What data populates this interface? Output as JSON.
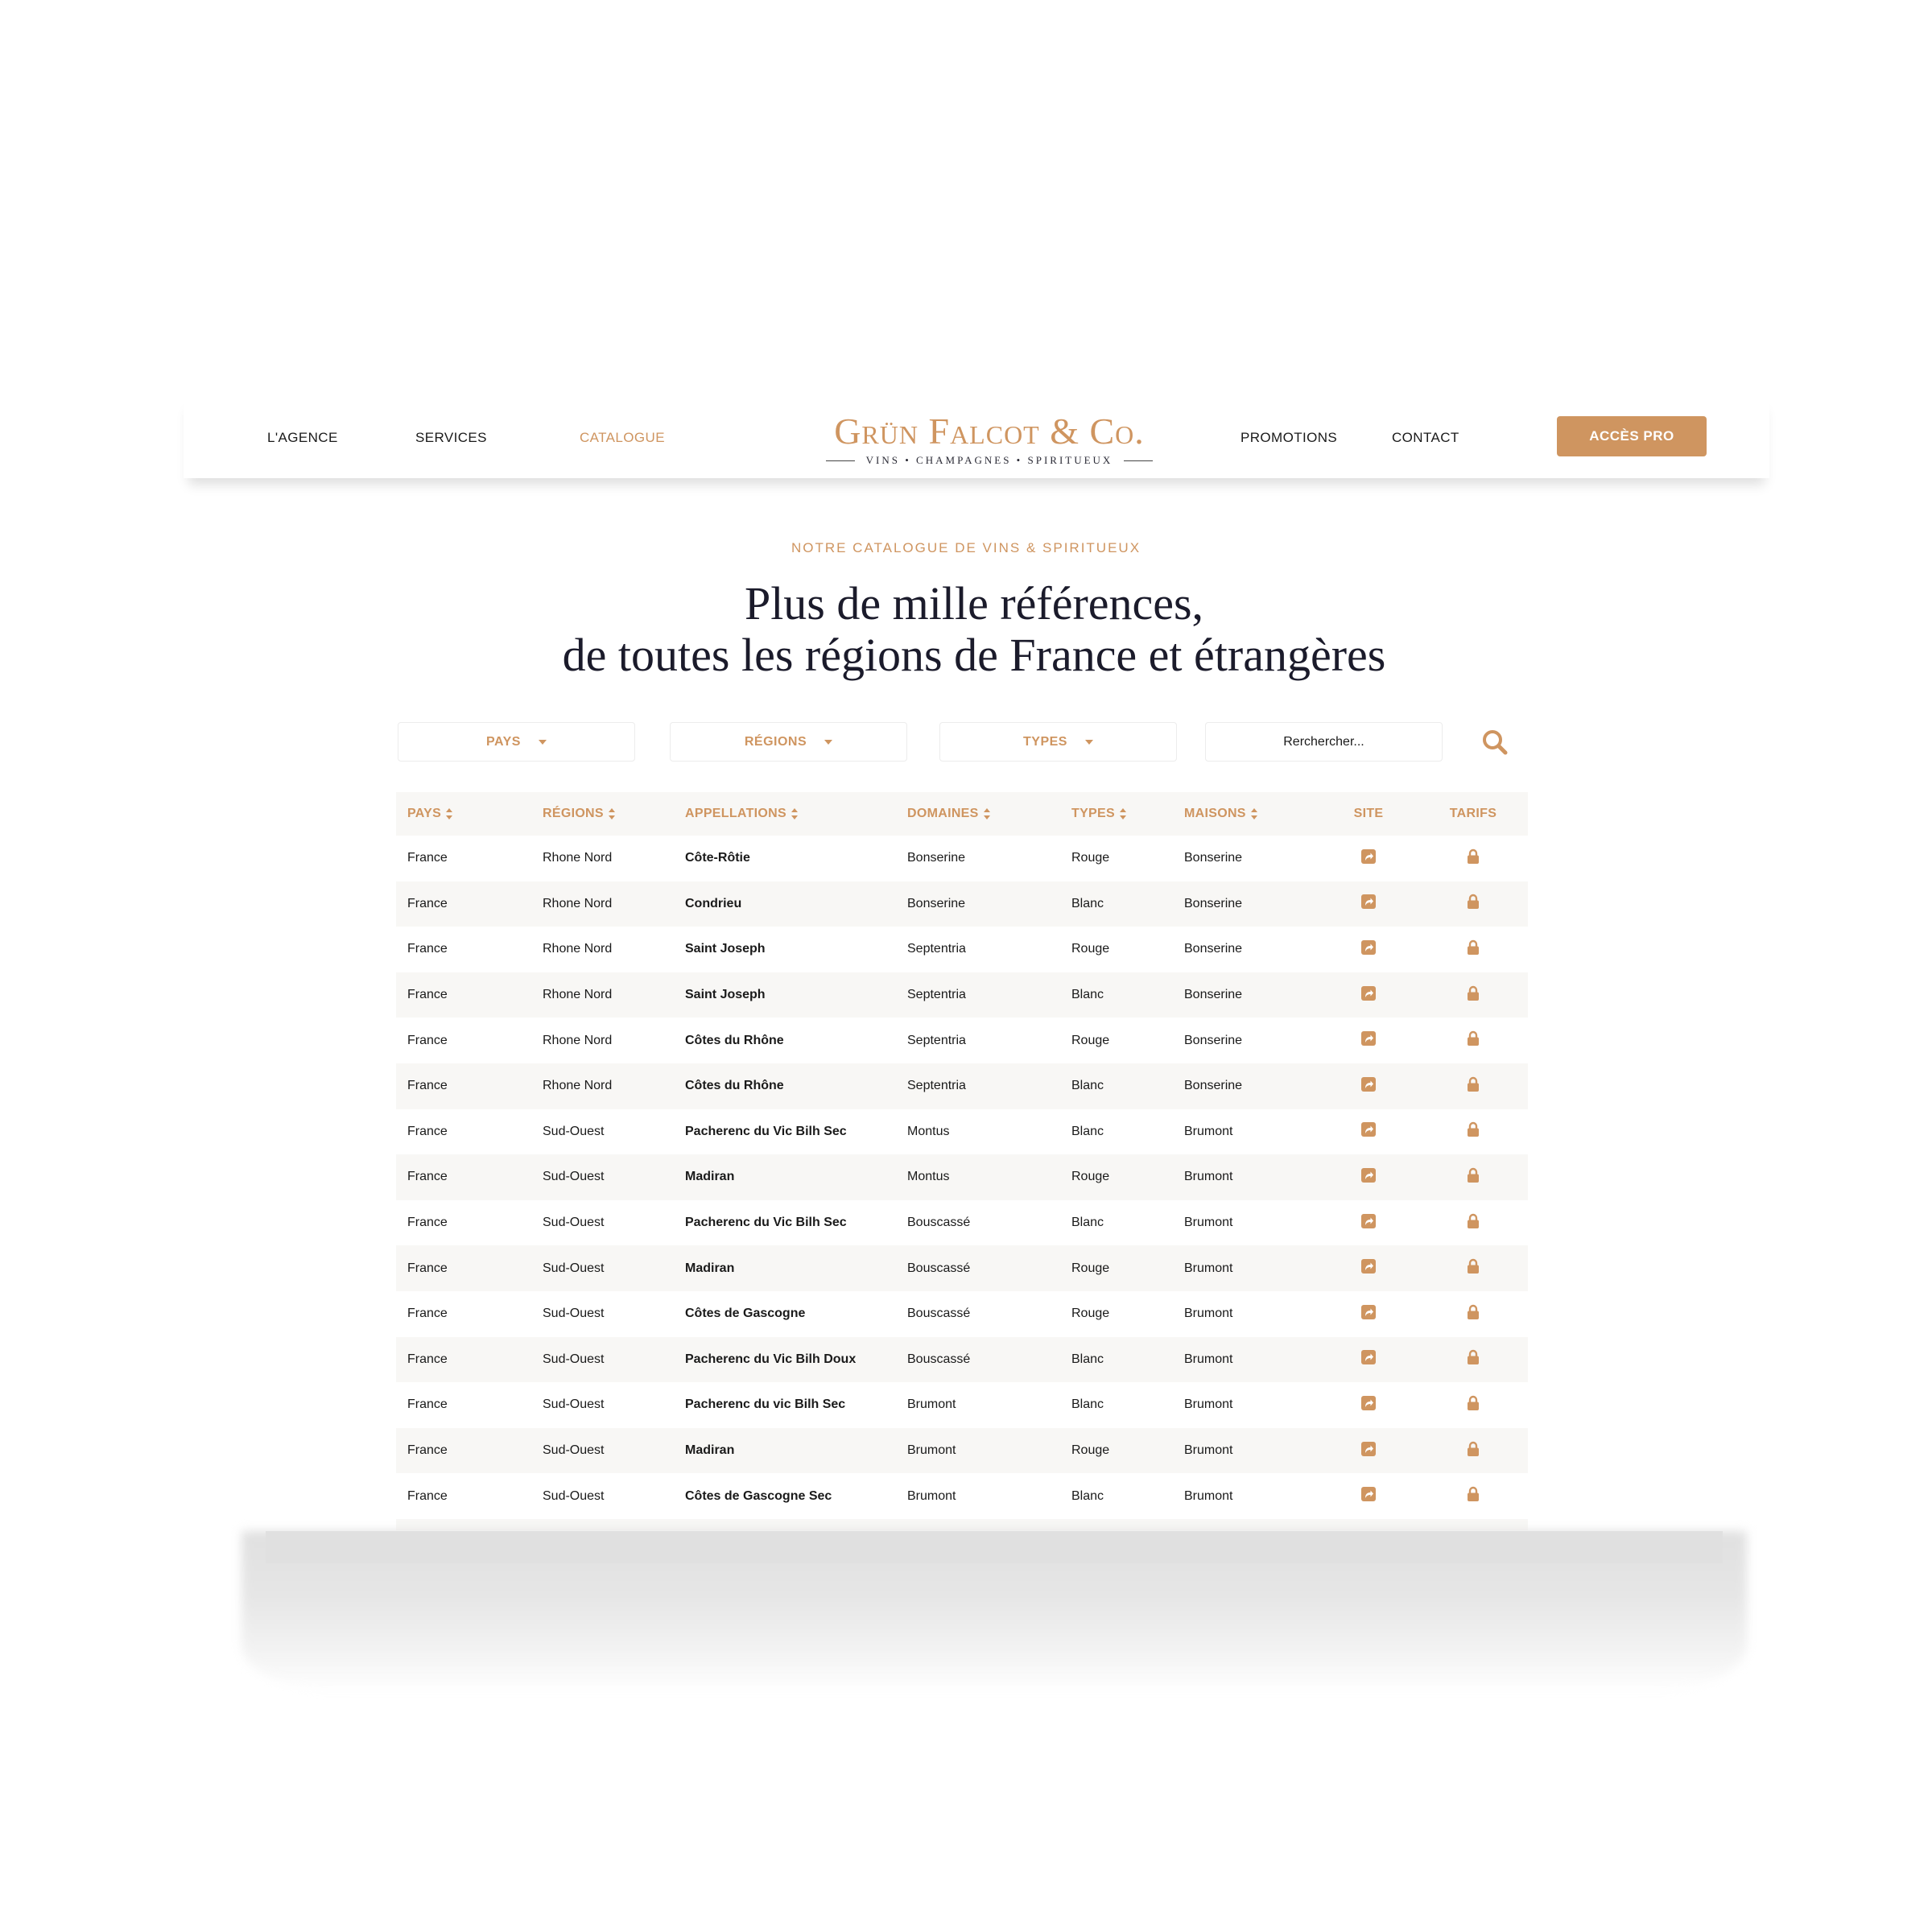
{
  "nav": {
    "links": [
      {
        "label": "L'AGENCE",
        "active": false
      },
      {
        "label": "SERVICES",
        "active": false
      },
      {
        "label": "CATALOGUE",
        "active": true
      },
      {
        "label": "PROMOTIONS",
        "active": false
      },
      {
        "label": "CONTACT",
        "active": false
      }
    ],
    "logo": {
      "title": "Grün Falcot & Co.",
      "tagline": "VINS • CHAMPAGNES • SPIRITUEUX"
    },
    "cta_label": "ACCÈS PRO"
  },
  "hero": {
    "eyebrow": "NOTRE CATALOGUE DE VINS & SPIRITUEUX",
    "headline_line1": "Plus de mille références,",
    "headline_line2": "de toutes les régions de France et étrangères"
  },
  "filters": {
    "pays": "PAYS",
    "regions": "RÉGIONS",
    "types": "TYPES",
    "search_placeholder": "Rerchercher...",
    "search_icon": "search-icon"
  },
  "table": {
    "headers": [
      "PAYS",
      "RÉGIONS",
      "APPELLATIONS",
      "DOMAINES",
      "TYPES",
      "MAISONS",
      "SITE",
      "TARIFS"
    ],
    "site_icon": "external-link-icon",
    "tarifs_icon": "lock-icon",
    "rows": [
      [
        "France",
        "Rhone Nord",
        "Côte-Rôtie",
        "Bonserine",
        "Rouge",
        "Bonserine"
      ],
      [
        "France",
        "Rhone Nord",
        "Condrieu",
        "Bonserine",
        "Blanc",
        "Bonserine"
      ],
      [
        "France",
        "Rhone Nord",
        "Saint Joseph",
        "Septentria",
        "Rouge",
        "Bonserine"
      ],
      [
        "France",
        "Rhone Nord",
        "Saint Joseph",
        "Septentria",
        "Blanc",
        "Bonserine"
      ],
      [
        "France",
        "Rhone Nord",
        "Côtes du Rhône",
        "Septentria",
        "Rouge",
        "Bonserine"
      ],
      [
        "France",
        "Rhone Nord",
        "Côtes du Rhône",
        "Septentria",
        "Blanc",
        "Bonserine"
      ],
      [
        "France",
        "Sud-Ouest",
        "Pacherenc du Vic Bilh Sec",
        "Montus",
        "Blanc",
        "Brumont"
      ],
      [
        "France",
        "Sud-Ouest",
        "Madiran",
        "Montus",
        "Rouge",
        "Brumont"
      ],
      [
        "France",
        "Sud-Ouest",
        "Pacherenc du Vic Bilh Sec",
        "Bouscassé",
        "Blanc",
        "Brumont"
      ],
      [
        "France",
        "Sud-Ouest",
        "Madiran",
        "Bouscassé",
        "Rouge",
        "Brumont"
      ],
      [
        "France",
        "Sud-Ouest",
        "Côtes de Gascogne",
        "Bouscassé",
        "Rouge",
        "Brumont"
      ],
      [
        "France",
        "Sud-Ouest",
        "Pacherenc du Vic Bilh Doux",
        "Bouscassé",
        "Blanc",
        "Brumont"
      ],
      [
        "France",
        "Sud-Ouest",
        "Pacherenc du vic Bilh Sec",
        "Brumont",
        "Blanc",
        "Brumont"
      ],
      [
        "France",
        "Sud-Ouest",
        "Madiran",
        "Brumont",
        "Rouge",
        "Brumont"
      ],
      [
        "France",
        "Sud-Ouest",
        "Côtes de Gascogne Sec",
        "Brumont",
        "Blanc",
        "Brumont"
      ],
      [
        "",
        "",
        "",
        "",
        "",
        ""
      ]
    ]
  },
  "colors": {
    "accent": "#cf9560",
    "text": "#1a1a1a",
    "headline": "#1b1b2b",
    "row_alt": "#f8f7f5"
  }
}
